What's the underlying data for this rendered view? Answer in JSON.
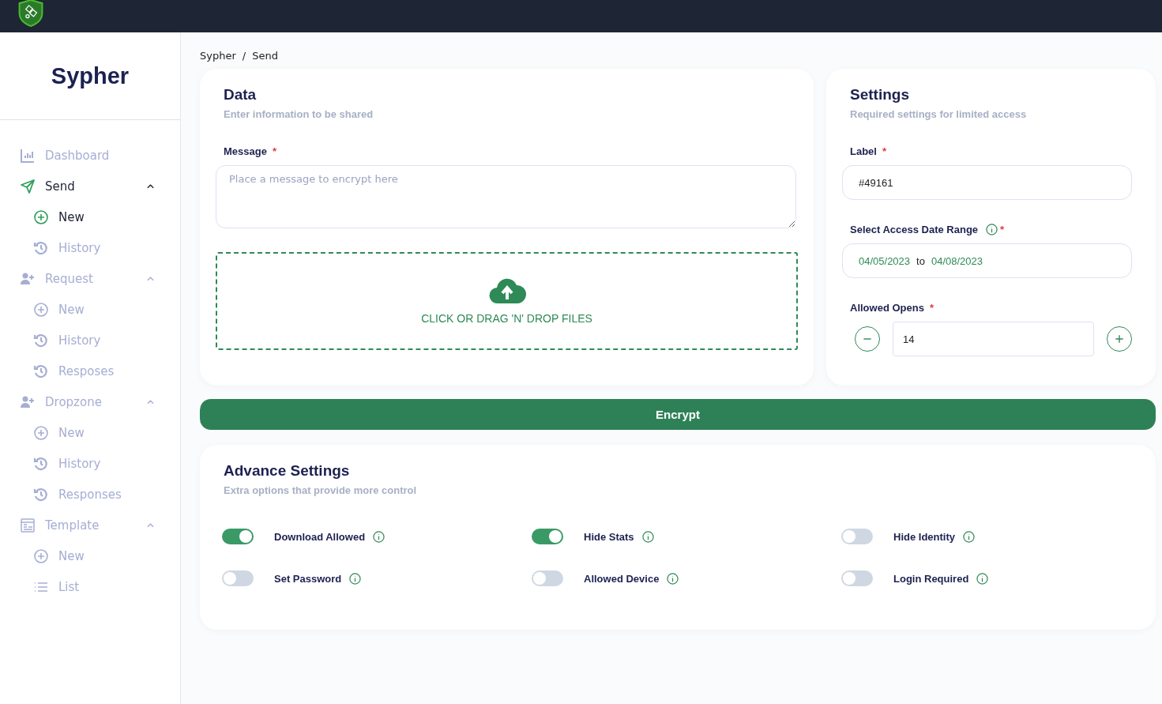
{
  "brand": {
    "name": "Sypher"
  },
  "sidebar": {
    "items": [
      {
        "label": "Dashboard",
        "kind": "chart",
        "selected": false
      },
      {
        "label": "Send",
        "kind": "send",
        "selected": true,
        "expanded": true,
        "children": [
          {
            "label": "New",
            "kind": "add",
            "selected": true
          },
          {
            "label": "History",
            "kind": "history",
            "selected": false
          }
        ]
      },
      {
        "label": "Request",
        "kind": "person",
        "selected": false,
        "expanded": true,
        "children": [
          {
            "label": "New",
            "kind": "add",
            "selected": false
          },
          {
            "label": "History",
            "kind": "history",
            "selected": false
          },
          {
            "label": "Resposes",
            "kind": "history",
            "selected": false
          }
        ]
      },
      {
        "label": "Dropzone",
        "kind": "person",
        "selected": false,
        "expanded": true,
        "children": [
          {
            "label": "New",
            "kind": "add",
            "selected": false
          },
          {
            "label": "History",
            "kind": "history",
            "selected": false
          },
          {
            "label": "Responses",
            "kind": "history",
            "selected": false
          }
        ]
      },
      {
        "label": "Template",
        "kind": "template",
        "selected": false,
        "expanded": true,
        "children": [
          {
            "label": "New",
            "kind": "add",
            "selected": false
          },
          {
            "label": "List",
            "kind": "list",
            "selected": false
          }
        ]
      }
    ]
  },
  "breadcrumb": {
    "items": [
      "Sypher",
      "Send"
    ],
    "separator": "/"
  },
  "data_card": {
    "title": "Data",
    "subtitle": "Enter information to be shared",
    "message_label": "Message",
    "message_required_mark": "*",
    "message_placeholder": "Place a message to encrypt here",
    "dropzone_text": "CLICK OR DRAG 'N' DROP FILES"
  },
  "settings_card": {
    "title": "Settings",
    "subtitle": "Required settings for limited access",
    "label_label": "Label",
    "label_required_mark": "*",
    "label_value": "#49161",
    "date_label": "Select Access Date Range",
    "date_required_mark": "*",
    "date_from": "04/05/2023",
    "date_sep": "to",
    "date_to": "04/08/2023",
    "opens_label": "Allowed Opens",
    "opens_required_mark": "*",
    "opens_value": "14"
  },
  "encrypt_button": "Encrypt",
  "advance": {
    "title": "Advance Settings",
    "subtitle": "Extra options that provide more control",
    "options": [
      {
        "label": "Download Allowed",
        "on": true
      },
      {
        "label": "Hide Stats",
        "on": true
      },
      {
        "label": "Hide Identity",
        "on": false
      },
      {
        "label": "Set Password",
        "on": false
      },
      {
        "label": "Allowed Device",
        "on": false
      },
      {
        "label": "Login Required",
        "on": false
      }
    ]
  }
}
